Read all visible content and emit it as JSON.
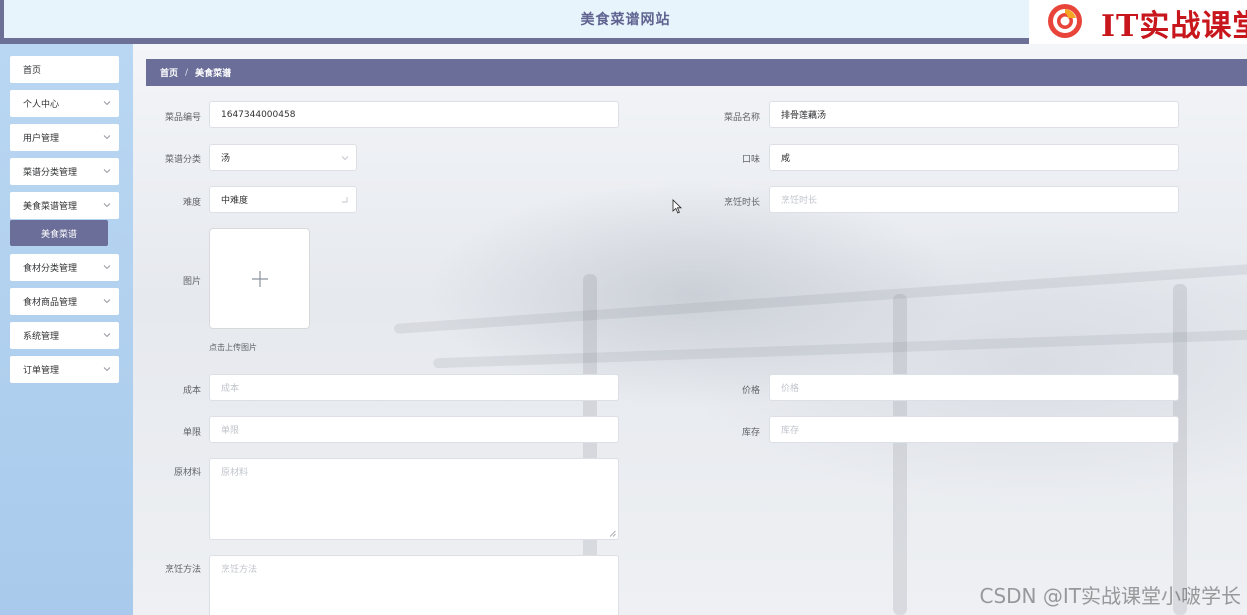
{
  "header": {
    "title": "美食菜谱网站",
    "logo_text": "IT实战课堂",
    "logo_icon": "chrome-logo-icon"
  },
  "sidebar": {
    "items": [
      {
        "label": "首页",
        "has_chevron": false
      },
      {
        "label": "个人中心",
        "has_chevron": true
      },
      {
        "label": "用户管理",
        "has_chevron": true
      },
      {
        "label": "菜谱分类管理",
        "has_chevron": true
      },
      {
        "label": "美食菜谱管理",
        "has_chevron": true
      },
      {
        "label": "食材分类管理",
        "has_chevron": true
      },
      {
        "label": "食材商品管理",
        "has_chevron": true
      },
      {
        "label": "系统管理",
        "has_chevron": true
      },
      {
        "label": "订单管理",
        "has_chevron": true
      }
    ],
    "active_submenu": "美食菜谱"
  },
  "breadcrumb": {
    "home": "首页",
    "separator": "/",
    "current": "美食菜谱"
  },
  "form": {
    "code": {
      "label": "菜品编号",
      "value": "1647344000458"
    },
    "name": {
      "label": "菜品名称",
      "value": "排骨莲藕汤"
    },
    "category": {
      "label": "菜谱分类",
      "value": "汤"
    },
    "taste": {
      "label": "口味",
      "value": "咸"
    },
    "difficulty": {
      "label": "难度",
      "value": "中难度"
    },
    "cook_time": {
      "label": "烹饪时长",
      "placeholder": "烹饪时长"
    },
    "image": {
      "label": "图片",
      "tip": "点击上传图片"
    },
    "cost": {
      "label": "成本",
      "placeholder": "成本"
    },
    "price": {
      "label": "价格",
      "placeholder": "价格"
    },
    "limit": {
      "label": "单限",
      "placeholder": "单限"
    },
    "stock": {
      "label": "库存",
      "placeholder": "库存"
    },
    "ingredients": {
      "label": "原材料",
      "placeholder": "原材料"
    },
    "method": {
      "label": "烹饪方法",
      "placeholder": "烹饪方法"
    }
  },
  "watermark": "CSDN @IT实战课堂小啵学长",
  "colors": {
    "accent": "#6b6e98",
    "header_bg": "#e8f4fc",
    "sidebar_bg": "#b9d7f2",
    "logo_red": "#c8161d"
  }
}
